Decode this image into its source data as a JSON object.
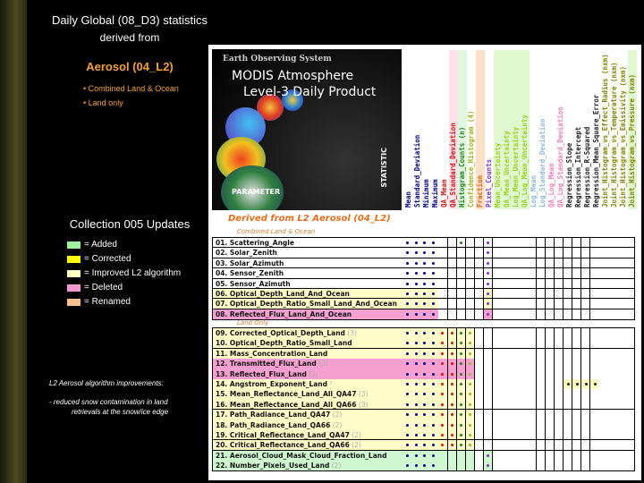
{
  "header": {
    "title": "Daily Global (08_D3) statistics",
    "subtitle": "derived from",
    "product": "Aerosol (04_L2)",
    "bullets": [
      "Combined Land & Ocean",
      "Land only"
    ]
  },
  "legend": {
    "title": "Collection 005 Updates",
    "items": [
      {
        "label": "= Added",
        "color": "#a0f0a0"
      },
      {
        "label": "= Corrected",
        "color": "#ffff00"
      },
      {
        "label": "= Improved L2 algorithm",
        "color": "#fffcc0"
      },
      {
        "label": "= Deleted",
        "color": "#f59ad0"
      },
      {
        "label": "= Renamed",
        "color": "#f5c090"
      }
    ]
  },
  "notes": {
    "heading": "L2 Aerosol  algorithm improvements:",
    "text1": "- reduced snow contamination in land",
    "text2": "retrievals at the snow/ice edge"
  },
  "image": {
    "line1": "Earth Observing System",
    "line2": "MODIS Atmosphere",
    "line3": "Level-3 Daily Product",
    "parameter": "PARAMETER",
    "statistic": "STATISTIC"
  },
  "columns": [
    {
      "label": "Mean",
      "color": "#000080"
    },
    {
      "label": "Standard_Deviation",
      "color": "#000080"
    },
    {
      "label": "Minimum",
      "color": "#000080"
    },
    {
      "label": "Maximum",
      "color": "#000080"
    },
    {
      "label": "QA_Mean",
      "color": "#d01010"
    },
    {
      "label": "QA_Standard_Deviation",
      "color": "#d01010",
      "bg": "#fde0e8"
    },
    {
      "label": "Histogram_Counts (n)",
      "color": "#208020",
      "bg": "#e0f8e0"
    },
    {
      "label": "Confidence_Histogram (4)",
      "color": "#a0b020"
    },
    {
      "label": "Fraction",
      "color": "#e06010",
      "bg": "#fde0c8"
    },
    {
      "label": "Pixel_Counts",
      "color": "#8030c0"
    },
    {
      "label": "Mean_Uncertainty",
      "color": "#a0d020",
      "bg": "#e0f8d0"
    },
    {
      "label": "QA_Mean_Uncertainty",
      "color": "#a0d020",
      "bg": "#e0f8d0"
    },
    {
      "label": "Log_Mean_Uncertainty",
      "color": "#a0d020",
      "bg": "#e0f8d0"
    },
    {
      "label": "QA_Log_Mean_Uncertainty",
      "color": "#a0d020",
      "bg": "#e0f8d0"
    },
    {
      "label": "Log_Mean",
      "color": "#90b8d8"
    },
    {
      "label": "Log_Standard_Deviation",
      "color": "#90b8d8"
    },
    {
      "label": "QA_Log_Mean",
      "color": "#f080c0"
    },
    {
      "label": "QA_Log_Standard_Deviation",
      "color": "#f080c0"
    },
    {
      "label": "Regression_Slope",
      "color": "#202020"
    },
    {
      "label": "Regression_Intercept",
      "color": "#202020"
    },
    {
      "label": "Regression_R-Squared",
      "color": "#202020"
    },
    {
      "label": "Regression_Mean_Square_Error",
      "color": "#202020"
    },
    {
      "label": "Joint_Histogram_vs_Effect_Radius (nxm)",
      "color": "#808000"
    },
    {
      "label": "Joint_Histogram_vs_Temperature (nxm)",
      "color": "#808000"
    },
    {
      "label": "Joint_Histogram_vs_Emissivity (nxm)",
      "color": "#808000"
    },
    {
      "label": "Joint_Histogram_vs_Pressure (nxm)",
      "color": "#808000",
      "bg": "#e0f8d0"
    }
  ],
  "table": {
    "title": "Derived from L2 Aerosol (04_L2)",
    "section1": "Combined Land & Ocean",
    "section2": "Land Only",
    "rows1": [
      {
        "name": "01. Scattering_Angle",
        "x": "",
        "bg": "",
        "dots": [
          0,
          1,
          2,
          3,
          6,
          9
        ]
      },
      {
        "name": "02. Solar_Zenith",
        "x": "",
        "bg": "",
        "dots": [
          0,
          1,
          2,
          3,
          9
        ]
      },
      {
        "name": "03. Solar_Azimuth",
        "x": "",
        "bg": "",
        "dots": [
          0,
          1,
          2,
          3,
          9
        ]
      },
      {
        "name": "04. Sensor_Zenith",
        "x": "",
        "bg": "",
        "dots": [
          0,
          1,
          2,
          3,
          9
        ]
      },
      {
        "name": "05. Sensor_Azimuth",
        "x": "",
        "bg": "",
        "dots": [
          0,
          1,
          2,
          3,
          9
        ]
      },
      {
        "name": "06. Optical_Depth_Land_And_Ocean",
        "x": "",
        "bg": "#fffcc8",
        "dots": [
          0,
          1,
          2,
          3,
          9
        ]
      },
      {
        "name": "07. Optical_Depth_Ratio_Small_Land_And_Ocean",
        "x": "",
        "bg": "#fffcc8",
        "dots": [
          0,
          1,
          2,
          3,
          9
        ]
      },
      {
        "name": "08. Reflected_Flux_Land_And_Ocean",
        "x": "",
        "bg": "#f5a0d0",
        "dots": [
          0,
          1,
          2,
          3,
          9
        ]
      }
    ],
    "rows2": [
      {
        "name": "09. Corrected_Optical_Depth_Land",
        "x": " (3)",
        "bg": "#fffcc8",
        "dots": [
          0,
          1,
          2,
          3,
          4,
          5,
          6,
          7
        ]
      },
      {
        "name": "10. Optical_Depth_Ratio_Small_Land",
        "x": "",
        "bg": "#fffcc8",
        "dots": [
          0,
          1,
          2,
          3,
          4,
          5,
          6,
          7
        ]
      },
      {
        "name": "11. Mass_Concentration_Land",
        "x": "",
        "bg": "#fffcc8",
        "dots": [
          0,
          1,
          2,
          3,
          4,
          5,
          6,
          7
        ]
      },
      {
        "name": "12. Transmitted_Flux_Land",
        "x": " (3)",
        "bg": "#f5a0d0",
        "dots": [
          0,
          1,
          2,
          3,
          4,
          5,
          6,
          7
        ]
      },
      {
        "name": "13. Reflected_Flux_Land",
        "x": " (3)",
        "bg": "#f5a0d0",
        "dots": [
          0,
          1,
          2,
          3,
          4,
          5,
          6,
          7
        ]
      },
      {
        "name": "14. Angstrom_Exponent_Land",
        "x": " ²",
        "bg": "#fffcc8",
        "dots": [
          0,
          1,
          2,
          3,
          4,
          5,
          6,
          7,
          18,
          19,
          20,
          21
        ]
      },
      {
        "name": "15. Mean_Reflectance_Land_All_QA47",
        "x": " (3)",
        "bg": "#fffcc8",
        "dots": [
          0,
          1,
          2,
          3,
          4,
          5,
          6,
          7
        ]
      },
      {
        "name": "16. Mean_Reflectance_Land_All_QA66",
        "x": " (3)",
        "bg": "#fffcc8",
        "dots": [
          0,
          1,
          2,
          3,
          4,
          5,
          6,
          7
        ]
      },
      {
        "name": "17. Path_Radiance_Land_QA47",
        "x": " (2)",
        "bg": "#fffcc8",
        "dots": [
          0,
          1,
          2,
          3,
          4,
          5,
          6,
          7
        ]
      },
      {
        "name": "18. Path_Radiance_Land_QA66",
        "x": " (2)",
        "bg": "#fffcc8",
        "dots": [
          0,
          1,
          2,
          3,
          4,
          5,
          6,
          7
        ]
      },
      {
        "name": "19. Critical_Reflectance_Land_QA47",
        "x": " (2)",
        "bg": "#fffcc8",
        "dots": [
          0,
          1,
          2,
          3,
          4,
          5,
          6,
          7
        ]
      },
      {
        "name": "20. Critical_Reflectance_Land_QA66",
        "x": " (2)",
        "bg": "#fffcc8",
        "dots": [
          0,
          1,
          2,
          3,
          4,
          5,
          6,
          7
        ]
      },
      {
        "name": "21. Aerosol_Cloud_Mask_Cloud_Fraction_Land",
        "x": "",
        "bg": "#d0f8d0",
        "dots": [
          0,
          1,
          2,
          3,
          9
        ]
      },
      {
        "name": "22. Number_Pixels_Used_Land",
        "x": " (2)",
        "bg": "#d0f8d0",
        "dots": [
          0,
          1,
          2,
          3,
          9
        ]
      }
    ]
  }
}
